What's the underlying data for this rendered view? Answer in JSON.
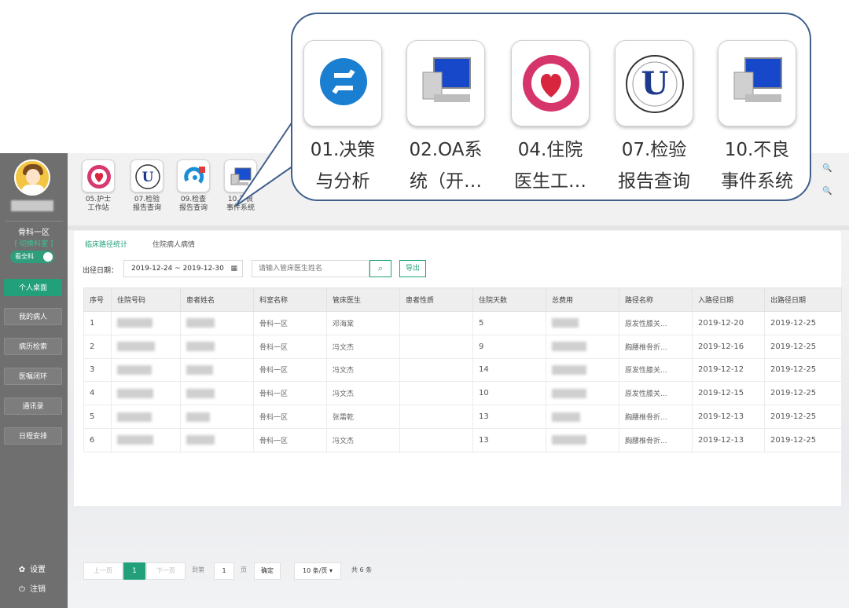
{
  "sidebar": {
    "dept": "骨科一区",
    "switch_dept": "[ 切换科室 ]",
    "toggle_label": "看全科",
    "nav": [
      "个人桌面",
      "我的病人",
      "病历检索",
      "医嘱闭环",
      "通讯录",
      "日程安排"
    ],
    "settings": "设置",
    "logout": "注销"
  },
  "toolbar": {
    "apps": [
      {
        "line1": "05.护士",
        "line2": "工作站"
      },
      {
        "line1": "07.检验",
        "line2": "报告查询"
      },
      {
        "line1": "09.检查",
        "line2": "报告查询"
      },
      {
        "line1": "10.不良",
        "line2": "事件系统"
      }
    ]
  },
  "callout": {
    "apps": [
      {
        "line1": "01.决策",
        "line2": "与分析",
        "icon": "decision-analysis-icon"
      },
      {
        "line1": "02.OA系",
        "line2": "统（开…",
        "icon": "computer-icon"
      },
      {
        "line1": "04.住院",
        "line2": "医生工…",
        "icon": "hospital-logo-icon"
      },
      {
        "line1": "07.检验",
        "line2": "报告查询",
        "icon": "lab-logo-icon"
      },
      {
        "line1": "10.不良",
        "line2": "事件系统",
        "icon": "computer-icon"
      }
    ]
  },
  "tabs": [
    "临床路径统计",
    "住院病人病情"
  ],
  "filter": {
    "date_label": "出径日期：",
    "date_range": "2019-12-24 ~ 2019-12-30",
    "search_placeholder": "请输入管床医生姓名",
    "export_label": "导出"
  },
  "table": {
    "headers": [
      "序号",
      "住院号码",
      "患者姓名",
      "科室名称",
      "管床医生",
      "患者性质",
      "住院天数",
      "总费用",
      "路径名称",
      "入路径日期",
      "出路径日期"
    ],
    "rows": [
      {
        "no": "1",
        "dept": "骨科一区",
        "doctor": "邓海棠",
        "days": "5",
        "path": "原发性膝关...",
        "in": "2019-12-20",
        "out": "2019-12-25"
      },
      {
        "no": "2",
        "dept": "骨科一区",
        "doctor": "冯文杰",
        "days": "9",
        "path": "胸腰椎骨折...",
        "in": "2019-12-16",
        "out": "2019-12-25"
      },
      {
        "no": "3",
        "dept": "骨科一区",
        "doctor": "冯文杰",
        "days": "14",
        "path": "原发性膝关...",
        "in": "2019-12-12",
        "out": "2019-12-25"
      },
      {
        "no": "4",
        "dept": "骨科一区",
        "doctor": "冯文杰",
        "days": "10",
        "path": "原发性膝关...",
        "in": "2019-12-15",
        "out": "2019-12-25"
      },
      {
        "no": "5",
        "dept": "骨科一区",
        "doctor": "张需乾",
        "days": "13",
        "path": "胸腰椎骨折...",
        "in": "2019-12-13",
        "out": "2019-12-25"
      },
      {
        "no": "6",
        "dept": "骨科一区",
        "doctor": "冯文杰",
        "days": "13",
        "path": "胸腰椎骨折...",
        "in": "2019-12-13",
        "out": "2019-12-25"
      }
    ]
  },
  "pager": {
    "prev": "上一页",
    "current": "1",
    "next": "下一页",
    "goto_label": "到第",
    "goto_value": "1",
    "page_unit": "页",
    "confirm": "确定",
    "page_size": "10 条/页",
    "total": "共 6 条"
  },
  "colors": {
    "accent": "#22a07a",
    "sidebar": "#6f6f6f",
    "callout_border": "#3f5f8a"
  }
}
